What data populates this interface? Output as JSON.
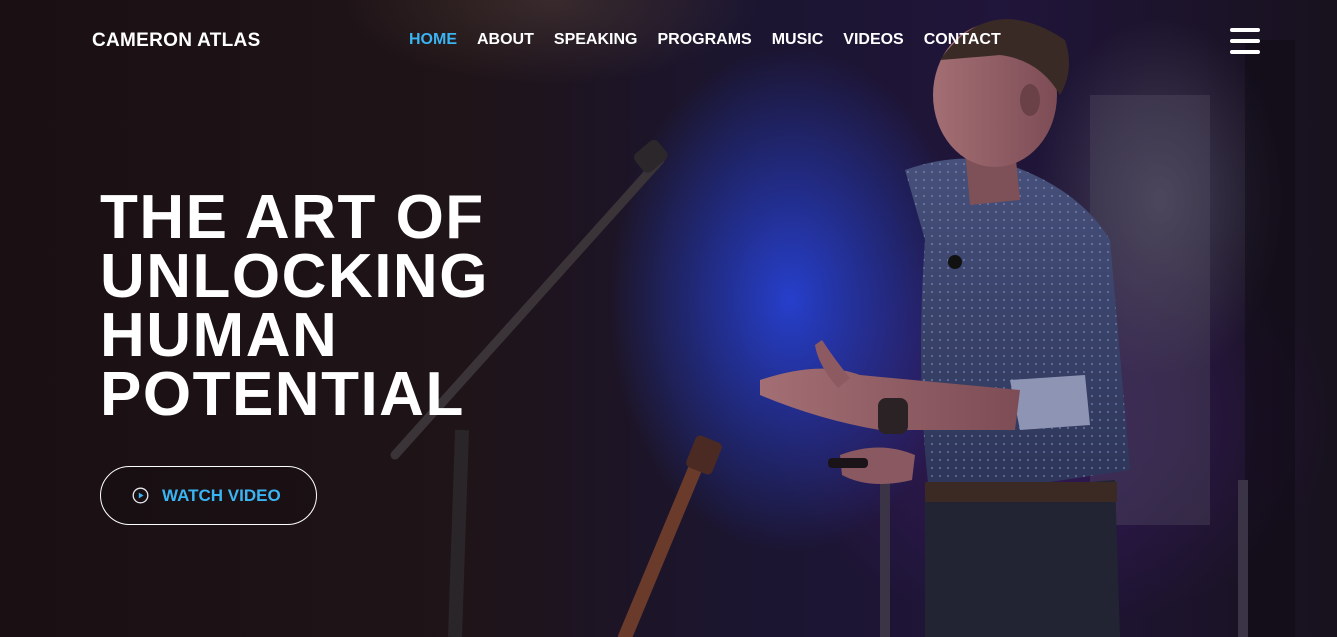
{
  "brand": {
    "name": "CAMERON ATLAS"
  },
  "nav": {
    "items": [
      {
        "label": "HOME",
        "active": true
      },
      {
        "label": "ABOUT"
      },
      {
        "label": "SPEAKING"
      },
      {
        "label": "PROGRAMS"
      },
      {
        "label": "MUSIC"
      },
      {
        "label": "VIDEOS"
      },
      {
        "label": "CONTACT"
      }
    ],
    "menu_icon": "hamburger-menu-icon"
  },
  "hero": {
    "headline_lines": [
      "THE ART OF",
      "UNLOCKING",
      "HUMAN",
      "POTENTIAL"
    ],
    "cta": {
      "label": "WATCH VIDEO",
      "icon": "play-circle-icon"
    },
    "background": "speaker on stage with microphone stand and guitar"
  },
  "colors": {
    "accent": "#3ab4f2",
    "text": "#ffffff",
    "stage_blue": "#2846e6"
  }
}
